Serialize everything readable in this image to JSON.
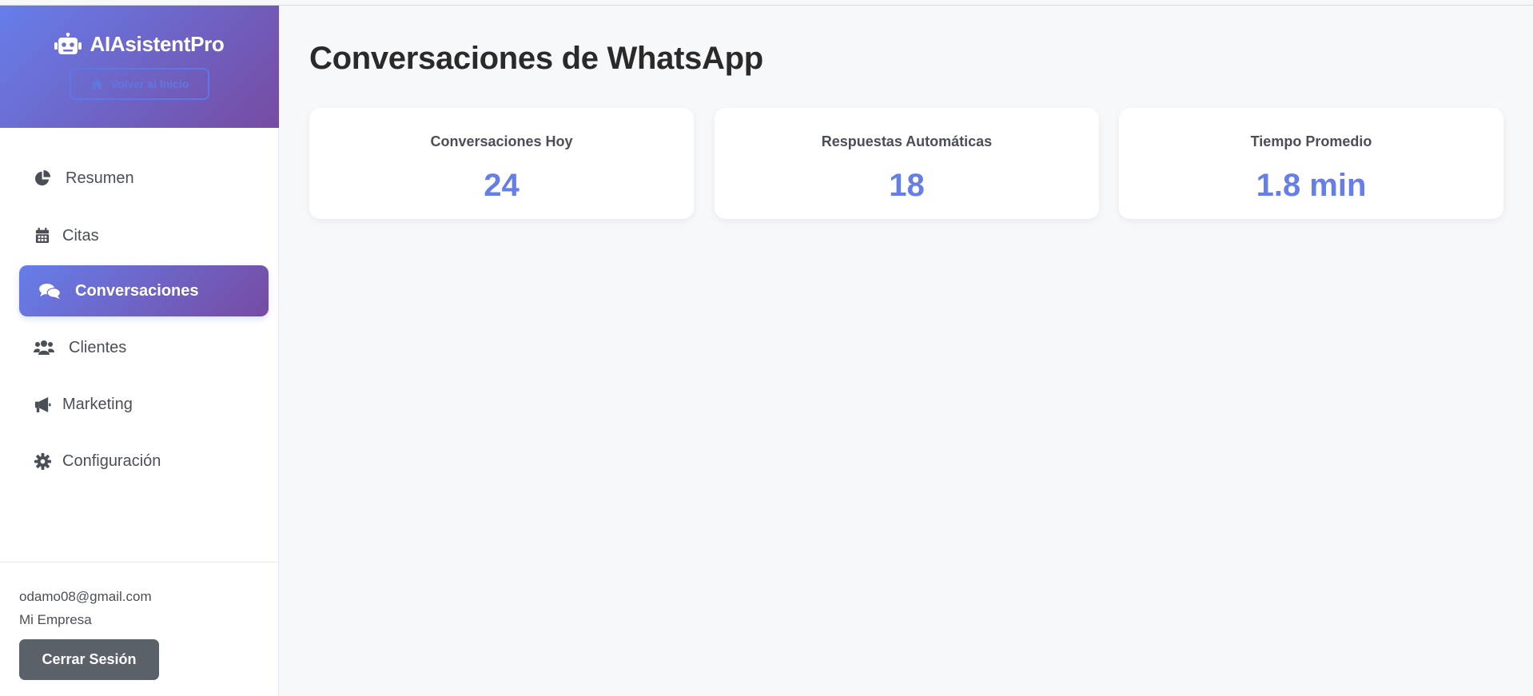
{
  "brand": {
    "title": "AIAsistentPro",
    "icon": "robot-icon",
    "home_button_label": "Volver al Inicio",
    "home_button_icon": "home-icon"
  },
  "sidebar": {
    "items": [
      {
        "label": "Resumen",
        "icon": "pie-chart-icon",
        "active": false
      },
      {
        "label": "Citas",
        "icon": "calendar-icon",
        "active": false
      },
      {
        "label": "Conversaciones",
        "icon": "chat-icon",
        "active": true
      },
      {
        "label": "Clientes",
        "icon": "users-icon",
        "active": false
      },
      {
        "label": "Marketing",
        "icon": "megaphone-icon",
        "active": false
      },
      {
        "label": "Configuración",
        "icon": "gear-icon",
        "active": false
      }
    ]
  },
  "user": {
    "email": "odamo08@gmail.com",
    "company": "Mi Empresa",
    "logout_label": "Cerrar Sesión"
  },
  "main": {
    "title": "Conversaciones de WhatsApp",
    "stats": [
      {
        "label": "Conversaciones Hoy",
        "value": "24"
      },
      {
        "label": "Respuestas Automáticas",
        "value": "18"
      },
      {
        "label": "Tiempo Promedio",
        "value": "1.8 min"
      }
    ]
  },
  "colors": {
    "accent": "#667eea",
    "gradient_end": "#764ba2",
    "logout_button": "#5a6169"
  }
}
